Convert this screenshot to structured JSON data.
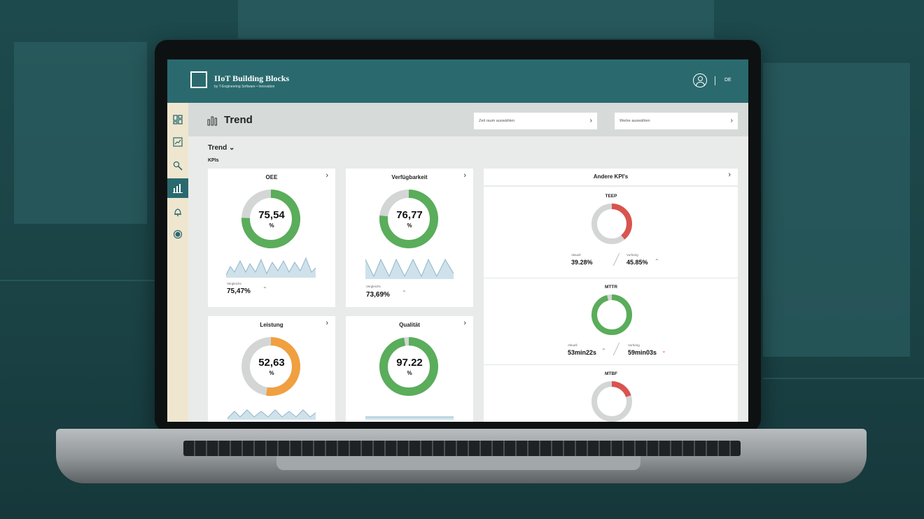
{
  "header": {
    "app_title": "IIoT Building Blocks",
    "app_subtitle": "by T-Engineering Software • Innovation",
    "lang": "DE"
  },
  "toolbar": {
    "title": "Trend",
    "select1_placeholder": "Zeit raum auswählen",
    "select2_placeholder": "Werke auswählen"
  },
  "breadcrumb": "Trend ⌄",
  "section_label": "KPIs",
  "kpi_cards": [
    {
      "title": "OEE",
      "value": "75,54",
      "unit": "%",
      "stat_label": "Vergleichs",
      "stat_value": "75,47%",
      "color": "#5aad5a",
      "fraction": 0.755
    },
    {
      "title": "Verfügbarkeit",
      "value": "76,77",
      "unit": "%",
      "stat_label": "Vergleichs",
      "stat_value": "73,69%",
      "color": "#5aad5a",
      "fraction": 0.768
    },
    {
      "title": "Leistung",
      "value": "52,63",
      "unit": "%",
      "color": "#f0a040",
      "fraction": 0.526
    },
    {
      "title": "Qualität",
      "value": "97.22",
      "unit": "%",
      "color": "#5aad5a",
      "fraction": 0.972
    }
  ],
  "other_kpis": {
    "title": "Andere KPI's",
    "items": [
      {
        "title": "TEEP",
        "label_a": "Aktuell",
        "value_a": "39.28%",
        "label_b": "Vorherig",
        "value_b": "45.85%",
        "color": "#d9534f",
        "fraction": 0.39
      },
      {
        "title": "MTTR",
        "label_a": "Aktuell",
        "value_a": "53min22s",
        "label_b": "Vorherig",
        "value_b": "59min03s",
        "color": "#5aad5a",
        "fraction": 0.96
      },
      {
        "title": "MTBF",
        "color": "#d9534f",
        "fraction": 0.2
      }
    ]
  },
  "colors": {
    "teal": "#2a6a6e",
    "green": "#5aad5a",
    "orange": "#f0a040",
    "red": "#d9534f",
    "gray_track": "#d3d6d5"
  }
}
